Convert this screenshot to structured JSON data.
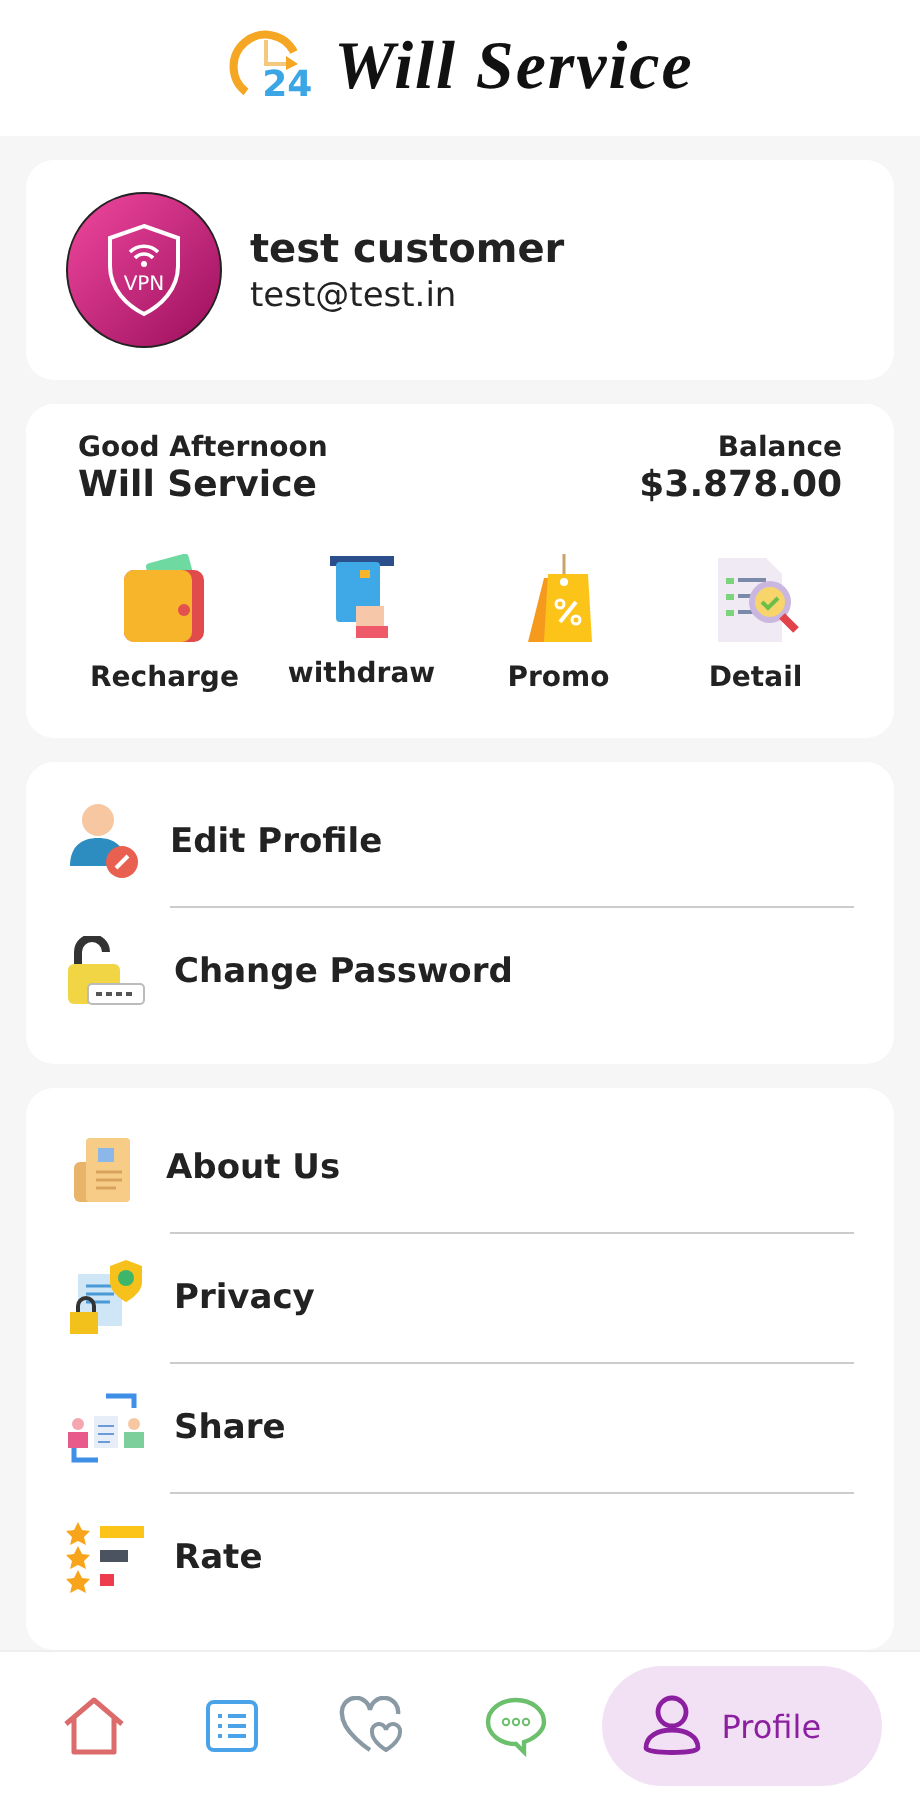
{
  "header": {
    "logo_badge": "24",
    "title": "Will Service"
  },
  "profile": {
    "avatar_text": "VPN",
    "name": "test customer",
    "email": "test@test.in"
  },
  "wallet": {
    "greeting": "Good Afternoon",
    "account": "Will Service",
    "balance_label": "Balance",
    "balance": "$3.878.00",
    "actions": [
      {
        "kind": "wallet",
        "label": "Recharge"
      },
      {
        "kind": "card",
        "label": "withdraw"
      },
      {
        "kind": "tag",
        "label": "Promo"
      },
      {
        "kind": "report",
        "label": "Detail"
      }
    ]
  },
  "account_menu": [
    {
      "kind": "user",
      "label": "Edit Profile"
    },
    {
      "kind": "lock",
      "label": "Change Password"
    }
  ],
  "info_menu": [
    {
      "kind": "document",
      "label": "About Us"
    },
    {
      "kind": "shield",
      "label": "Privacy"
    },
    {
      "kind": "share",
      "label": "Share"
    },
    {
      "kind": "rate",
      "label": "Rate"
    }
  ],
  "bottom_nav": [
    {
      "kind": "home",
      "selected": false
    },
    {
      "kind": "list",
      "selected": false
    },
    {
      "kind": "hearts",
      "selected": false
    },
    {
      "kind": "chat",
      "selected": false
    },
    {
      "kind": "profile",
      "label": "Profile",
      "selected": true
    }
  ]
}
